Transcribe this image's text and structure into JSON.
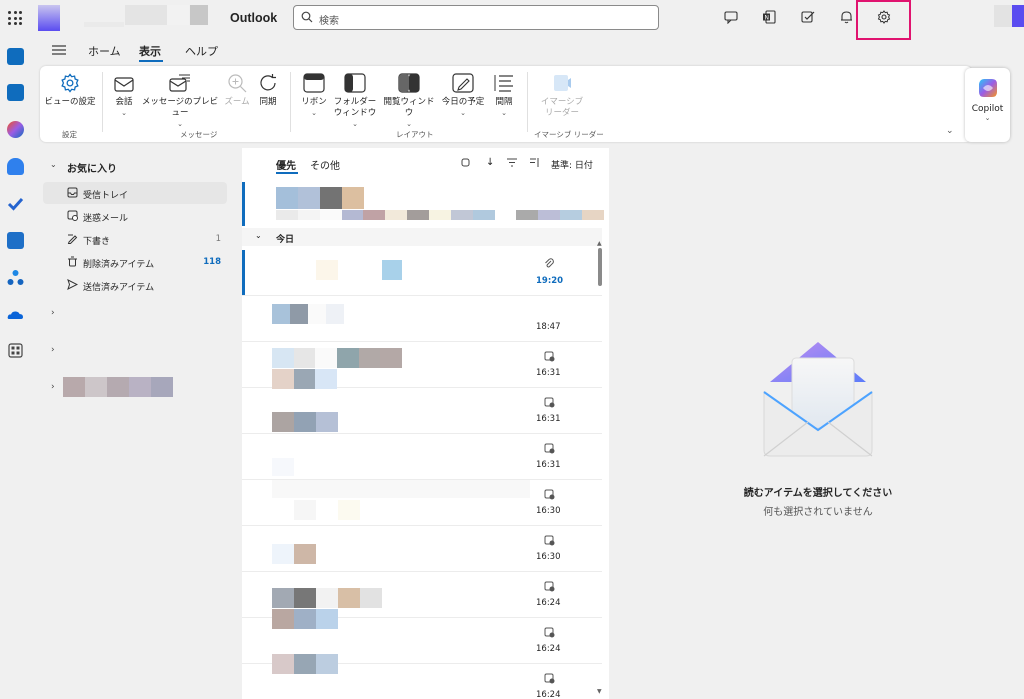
{
  "app": {
    "title": "Outlook"
  },
  "search": {
    "placeholder": "検索"
  },
  "tabs": {
    "home": "ホーム",
    "view": "表示",
    "help": "ヘルプ"
  },
  "ribbon": {
    "view_settings": "ビューの設定",
    "conversation": "会話",
    "message_preview": "メッセージのプレビュー",
    "zoom": "ズーム",
    "sync": "同期",
    "ribbon_btn": "リボン",
    "folder_pane_1": "フォルダー",
    "folder_pane_2": "ウィンドウ",
    "reading_pane": "閲覧ウィンドウ",
    "my_day": "今日の予定",
    "spacing": "間隔",
    "immersive_1": "イマーシブ",
    "immersive_2": "リーダー",
    "group_settings": "設定",
    "group_messages": "メッセージ",
    "group_layout": "レイアウト",
    "group_immersive": "イマーシブ リーダー"
  },
  "copilot": {
    "label": "Copilot"
  },
  "folders": {
    "favorites": "お気に入り",
    "items": [
      {
        "label": "受信トレイ",
        "count": ""
      },
      {
        "label": "迷惑メール",
        "count": ""
      },
      {
        "label": "下書き",
        "count": "1"
      },
      {
        "label": "削除済みアイテム",
        "count": "118"
      },
      {
        "label": "送信済みアイテム",
        "count": ""
      }
    ]
  },
  "list": {
    "tab_focused": "優先",
    "tab_other": "その他",
    "sort_label": "基準: 日付",
    "group_today": "今日",
    "times": [
      "19:20",
      "18:47",
      "16:31",
      "16:31",
      "16:31",
      "16:30",
      "16:30",
      "16:24",
      "16:24",
      "16:24"
    ]
  },
  "reading": {
    "empty_title": "読むアイテムを選択してください",
    "empty_sub": "何も選択されていません"
  },
  "colors": {
    "accent": "#0f6cbd",
    "highlight": "#e0136f"
  }
}
